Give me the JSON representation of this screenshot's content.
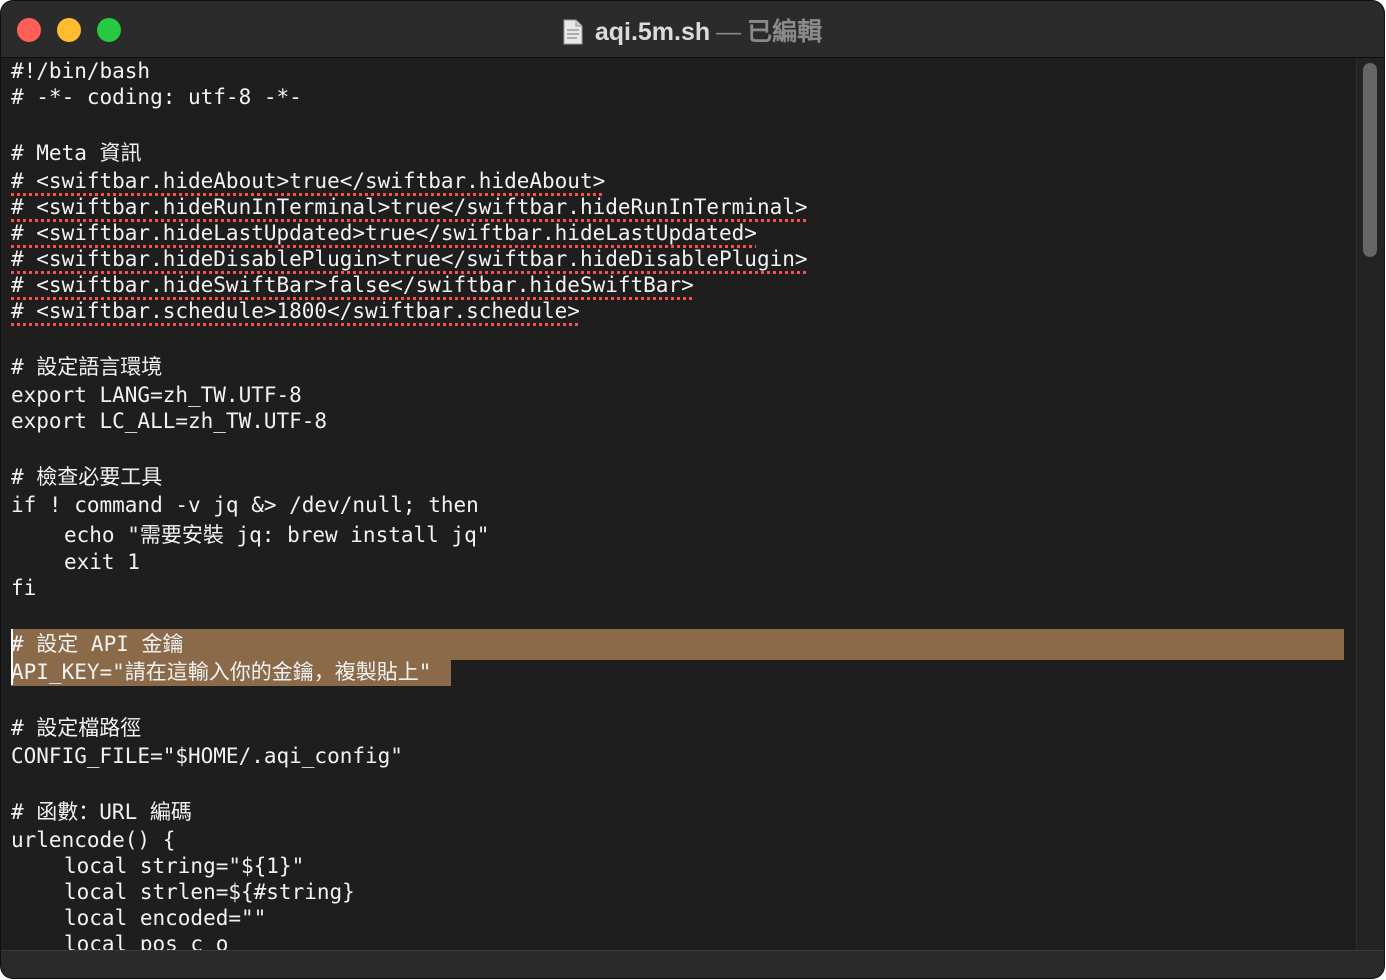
{
  "window": {
    "filename": "aqi.5m.sh",
    "separator": "—",
    "status": "已編輯",
    "selection_color": "#8b6a49",
    "text_color": "#f2f2f2",
    "background_color": "#1e1e1e"
  },
  "editor": {
    "lines": [
      "#!/bin/bash",
      "# -*- coding: utf-8 -*-",
      "",
      "# Meta 資訊",
      "# <swiftbar.hideAbout>true</swiftbar.hideAbout>",
      "# <swiftbar.hideRunInTerminal>true</swiftbar.hideRunInTerminal>",
      "# <swiftbar.hideLastUpdated>true</swiftbar.hideLastUpdated>",
      "# <swiftbar.hideDisablePlugin>true</swiftbar.hideDisablePlugin>",
      "# <swiftbar.hideSwiftBar>false</swiftbar.hideSwiftBar>",
      "# <swiftbar.schedule>1800</swiftbar.schedule>",
      "",
      "# 設定語言環境",
      "export LANG=zh_TW.UTF-8",
      "export LC_ALL=zh_TW.UTF-8",
      "",
      "# 檢查必要工具",
      "if ! command -v jq &> /dev/null; then",
      "echo \"需要安裝 jq: brew install jq\"",
      "exit 1",
      "fi",
      "",
      "# 設定 API 金鑰",
      "API_KEY=\"請在這輸入你的金鑰，複製貼上\"",
      "",
      "# 設定檔路徑",
      "CONFIG_FILE=\"$HOME/.aqi_config\"",
      "",
      "# 函數：URL 編碼",
      "urlencode() {",
      "local string=\"${1}\"",
      "local strlen=${#string}",
      "local encoded=\"\"",
      "local pos c o"
    ]
  }
}
